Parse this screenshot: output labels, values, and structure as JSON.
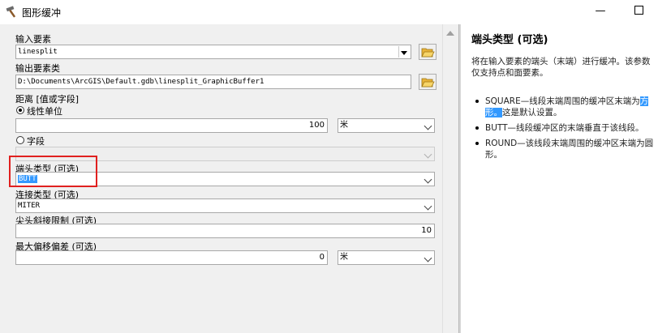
{
  "window": {
    "title": "图形缓冲",
    "minimize_glyph": "—",
    "close_glyph": "✕"
  },
  "form": {
    "input_features": {
      "label": "输入要素",
      "value": "linesplit"
    },
    "output_feature_class": {
      "label": "输出要素类",
      "value": "D:\\Documents\\ArcGIS\\Default.gdb\\linesplit_GraphicBuffer1"
    },
    "distance": {
      "label": "距离 [值或字段]",
      "linear_unit_label": "线性单位",
      "value": "100",
      "unit": "米",
      "field_label": "字段",
      "field_value": ""
    },
    "line_caps": {
      "label": "端头类型 (可选)",
      "value": "BUTT"
    },
    "line_joins": {
      "label": "连接类型 (可选)",
      "value": "MITER"
    },
    "miter_limit": {
      "label": "尖头斜接限制 (可选)",
      "value": "10"
    },
    "max_deviation": {
      "label": "最大偏移偏差 (可选)",
      "value": "0",
      "unit": "米"
    }
  },
  "help": {
    "title": "端头类型 (可选)",
    "intro": "将在输入要素的端头（末端）进行缓冲。该参数仅支持点和面要素。",
    "items": [
      {
        "pre": "SQUARE—线段末端周围的缓冲区末端为",
        "highlight": "方形。",
        "post": "这是默认设置。"
      },
      {
        "pre": "BUTT—线段缓冲区的末端垂直于该线段。",
        "highlight": "",
        "post": ""
      },
      {
        "pre": "ROUND—该线段末端周围的缓冲区末端为圆形。",
        "highlight": "",
        "post": ""
      }
    ]
  },
  "colors": {
    "selection": "#3399ff",
    "highlight_box": "#e0201f"
  },
  "icons": [
    "hammer-icon",
    "folder-open-icon",
    "chevron-down-icon",
    "scroll-up-icon"
  ]
}
